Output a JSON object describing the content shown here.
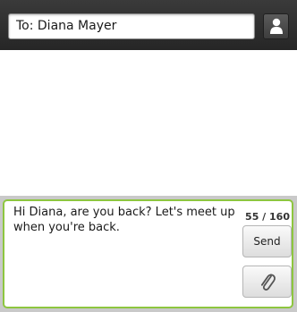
{
  "header": {
    "to_field_text": "To: Diana Mayer",
    "contact_icon": "person-icon"
  },
  "compose": {
    "message_text": "Hi Diana, are you back? Let's meet up when you're back.",
    "char_counter": "55 / 160",
    "send_label": "Send",
    "attach_icon": "paperclip-icon",
    "accent_color": "#8dc63f"
  }
}
